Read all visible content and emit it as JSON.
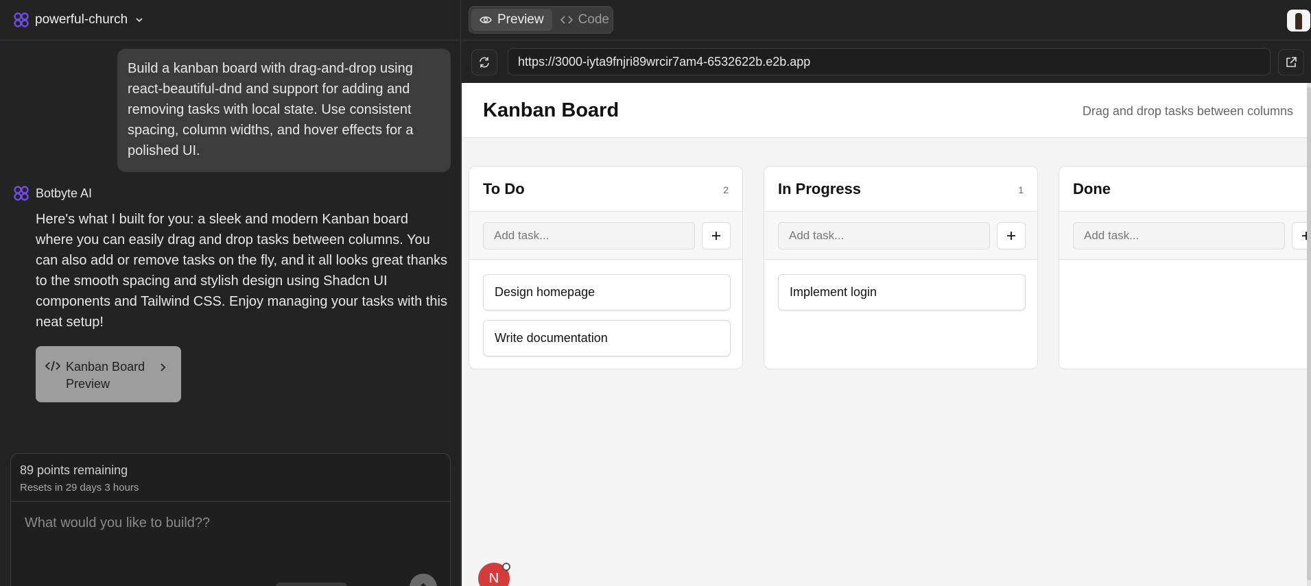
{
  "app": {
    "project_name": "powerful-church"
  },
  "chat": {
    "user_message": "Build a kanban board with drag-and-drop using react-beautiful-dnd and support for adding and removing tasks with local state. Use consistent spacing, column widths, and hover effects for a polished UI.",
    "ai_name": "Botbyte AI",
    "ai_message": "Here's what I built for you: a sleek and modern Kanban board where you can easily drag and drop tasks between columns. You can also add or remove tasks on the fly, and it all looks great thanks to the smooth spacing and stylish design using Shadcn UI components and Tailwind CSS. Enjoy managing your tasks with this neat setup!",
    "preview_card_label": "Kanban Board Preview"
  },
  "composer": {
    "points": "89 points remaining",
    "resets": "Resets in 29 days 3 hours",
    "placeholder": "What would you like to build??"
  },
  "preview": {
    "tab_preview": "Preview",
    "tab_code": "Code",
    "url": "https://3000-iyta9fnjri89wrcir7am4-6532622b.e2b.app"
  },
  "kanban": {
    "title": "Kanban Board",
    "subtitle": "Drag and drop tasks between columns",
    "add_placeholder": "Add task...",
    "columns": [
      {
        "title": "To Do",
        "count": "2",
        "tasks": [
          "Design homepage",
          "Write documentation"
        ]
      },
      {
        "title": "In Progress",
        "count": "1",
        "tasks": [
          "Implement login"
        ]
      },
      {
        "title": "Done",
        "count": "",
        "tasks": []
      }
    ],
    "badge_letter": "N"
  },
  "colors": {
    "accent": "#6d4de6",
    "panel": "#232323",
    "badge": "#d63b3b"
  },
  "icons": [
    "logo-icon",
    "chevron-down-icon",
    "eye-icon",
    "code-icon",
    "reload-icon",
    "external-link-icon",
    "plus-icon",
    "chevron-right-icon",
    "send-icon"
  ]
}
